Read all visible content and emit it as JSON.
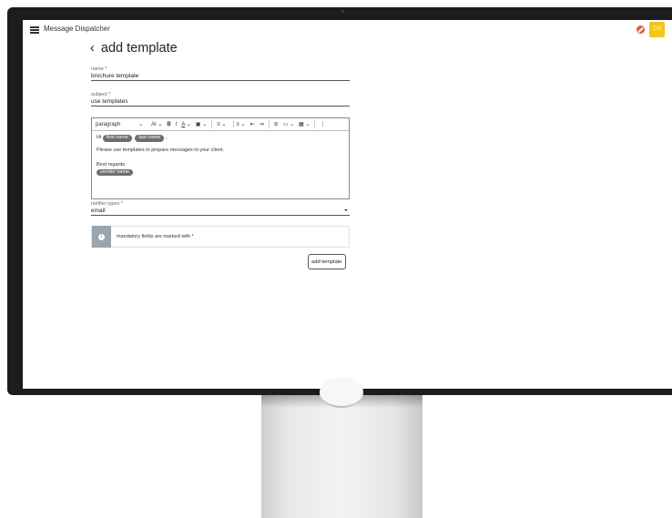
{
  "app": {
    "title": "Message Dispatcher",
    "avatar_initials": "CH"
  },
  "page": {
    "back_glyph": "‹",
    "title": "add template"
  },
  "form": {
    "name": {
      "label": "name *",
      "value": "brochure template"
    },
    "subject": {
      "label": "subject *",
      "value": "use templates"
    },
    "notifier": {
      "label": "notifier types *",
      "value": "email"
    },
    "info_text": "mandatory fields are marked with *",
    "submit_label": "add template"
  },
  "toolbar": {
    "paragraph": "paragraph",
    "caret": "⌄",
    "font_size": "AI",
    "bold": "B",
    "italic": "I",
    "font_color": "A",
    "highlight": "▣",
    "align": "≡",
    "list": "⋮≡",
    "outdent": "⇤",
    "indent": "⇥",
    "link": "⊘",
    "image": "▭",
    "table": "▦",
    "more": "⋮"
  },
  "editor": {
    "greeting": "Hi",
    "chip_first_name": "first name",
    "chip_last_name": "last name",
    "comma": ",",
    "body_line": "Please use templates to prepare messages to your client.",
    "regards": "Best regards",
    "chip_sender_name": "sender name"
  },
  "icons": {
    "menu": "hamburger-icon",
    "alert": "cancel-circle-icon",
    "info": "info-icon"
  },
  "colors": {
    "avatar": "#f5c417",
    "alert": "#e05a4a",
    "chip": "#6e6e6e",
    "info_strip": "#9aa5ad"
  }
}
